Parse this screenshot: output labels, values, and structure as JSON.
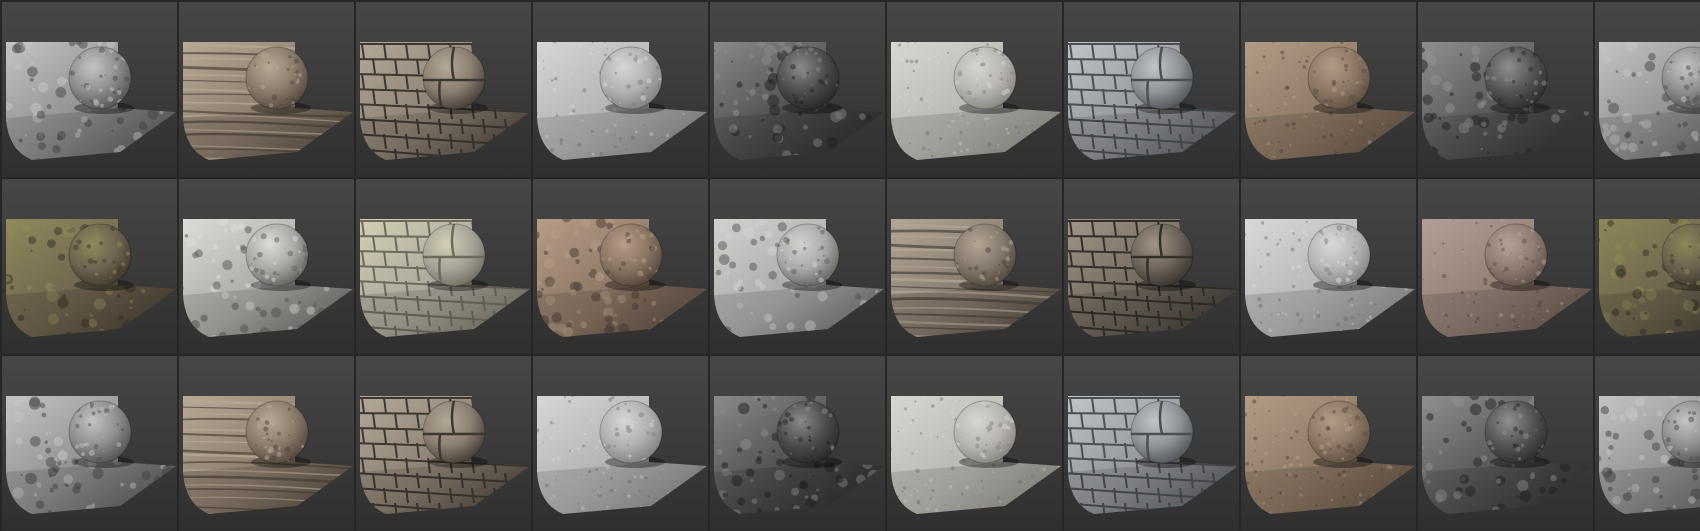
{
  "gallery": {
    "columns": 10,
    "rows": 3,
    "backdrop": {
      "top": "#474747",
      "bottom": "#2f2f2f",
      "separator": "#262626"
    },
    "materials": [
      {
        "name": "rock-gray-cracked",
        "icon": "material-swatch-icon",
        "base": "#8d8d8d",
        "dark": "#4e4e4e",
        "light": "#c4c4c4",
        "pattern": "rock"
      },
      {
        "name": "sandstone-layered",
        "icon": "material-swatch-icon",
        "base": "#8a7b6b",
        "dark": "#4f443a",
        "light": "#b8a996",
        "pattern": "strata"
      },
      {
        "name": "stone-brick-wall",
        "icon": "material-swatch-icon",
        "base": "#8a7e70",
        "dark": "#3e3832",
        "light": "#b3a898",
        "pattern": "bricks"
      },
      {
        "name": "concrete-smooth",
        "icon": "material-swatch-icon",
        "base": "#b0b0b0",
        "dark": "#7d7d7d",
        "light": "#d6d6d6",
        "pattern": "fine"
      },
      {
        "name": "granite-dark-rough",
        "icon": "material-swatch-icon",
        "base": "#4b4b4b",
        "dark": "#262626",
        "light": "#8a8a8a",
        "pattern": "rock"
      },
      {
        "name": "limestone-pale",
        "icon": "material-swatch-icon",
        "base": "#b8b6b1",
        "dark": "#85827c",
        "light": "#d8d6d0",
        "pattern": "fine"
      },
      {
        "name": "stone-blocks-gray",
        "icon": "material-swatch-icon",
        "base": "#8f9296",
        "dark": "#4c4f53",
        "light": "#c2c5c8",
        "pattern": "bricks"
      },
      {
        "name": "sand-brown",
        "icon": "material-swatch-icon",
        "base": "#8c7764",
        "dark": "#5c4c3f",
        "light": "#b29c86",
        "pattern": "fine"
      },
      {
        "name": "gravel-dark",
        "icon": "material-swatch-icon",
        "base": "#535353",
        "dark": "#2a2a2a",
        "light": "#8f8f8f",
        "pattern": "rock"
      },
      {
        "name": "rock-gray-cracked-2",
        "icon": "material-swatch-icon",
        "base": "#8d8d8d",
        "dark": "#4e4e4e",
        "light": "#c4c4c4",
        "pattern": "rock"
      },
      {
        "name": "moss-soil-rock",
        "icon": "material-swatch-icon",
        "base": "#6e6350",
        "dark": "#3d362a",
        "light": "#8f8a5a",
        "pattern": "rock"
      },
      {
        "name": "pebble-white",
        "icon": "material-swatch-icon",
        "base": "#a8a8a4",
        "dark": "#5e5e5b",
        "light": "#dcdcd8",
        "pattern": "pebble"
      },
      {
        "name": "flagstone-lichen",
        "icon": "material-swatch-icon",
        "base": "#a7a49a",
        "dark": "#6e6a5e",
        "light": "#d4cfb3",
        "pattern": "bricks"
      },
      {
        "name": "dirt-gravel-brown",
        "icon": "material-swatch-icon",
        "base": "#8a7563",
        "dark": "#52433a",
        "light": "#b59d87",
        "pattern": "pebble"
      },
      {
        "name": "rock-white-chipped",
        "icon": "material-swatch-icon",
        "base": "#a9a9a7",
        "dark": "#5f5f5c",
        "light": "#d2d2cf",
        "pattern": "rock"
      },
      {
        "name": "sandstone-layered-2",
        "icon": "material-swatch-icon",
        "base": "#85796c",
        "dark": "#4c443b",
        "light": "#b3a696",
        "pattern": "strata"
      },
      {
        "name": "stone-brick-dark",
        "icon": "material-swatch-icon",
        "base": "#6d645a",
        "dark": "#33302b",
        "light": "#a09585",
        "pattern": "bricks"
      },
      {
        "name": "concrete-light",
        "icon": "material-swatch-icon",
        "base": "#b5b5b5",
        "dark": "#818181",
        "light": "#d9d9d9",
        "pattern": "fine"
      },
      {
        "name": "clay-dust-pink",
        "icon": "material-swatch-icon",
        "base": "#8f7c72",
        "dark": "#5e4f48",
        "light": "#b39f95",
        "pattern": "fine"
      },
      {
        "name": "moss-soil-rock-2",
        "icon": "material-swatch-icon",
        "base": "#6b624d",
        "dark": "#3a3429",
        "light": "#8d8758",
        "pattern": "rock"
      },
      {
        "name": "rock-gray-cracked-3",
        "icon": "material-swatch-icon",
        "base": "#8d8d8d",
        "dark": "#4e4e4e",
        "light": "#c4c4c4",
        "pattern": "rock"
      },
      {
        "name": "sandstone-layered-3",
        "icon": "material-swatch-icon",
        "base": "#8a7b6b",
        "dark": "#4f443a",
        "light": "#b8a996",
        "pattern": "strata"
      },
      {
        "name": "stone-brick-wall-2",
        "icon": "material-swatch-icon",
        "base": "#8a7e70",
        "dark": "#3e3832",
        "light": "#b3a898",
        "pattern": "bricks"
      },
      {
        "name": "concrete-smooth-2",
        "icon": "material-swatch-icon",
        "base": "#b0b0b0",
        "dark": "#7d7d7d",
        "light": "#d6d6d6",
        "pattern": "fine"
      },
      {
        "name": "granite-dark-rough-2",
        "icon": "material-swatch-icon",
        "base": "#4b4b4b",
        "dark": "#262626",
        "light": "#8a8a8a",
        "pattern": "rock"
      },
      {
        "name": "limestone-pale-2",
        "icon": "material-swatch-icon",
        "base": "#b8b6b1",
        "dark": "#85827c",
        "light": "#d8d6d0",
        "pattern": "fine"
      },
      {
        "name": "stone-blocks-gray-2",
        "icon": "material-swatch-icon",
        "base": "#8f9296",
        "dark": "#4c4f53",
        "light": "#c2c5c8",
        "pattern": "bricks"
      },
      {
        "name": "sand-brown-2",
        "icon": "material-swatch-icon",
        "base": "#8c7764",
        "dark": "#5c4c3f",
        "light": "#b29c86",
        "pattern": "fine"
      },
      {
        "name": "gravel-dark-2",
        "icon": "material-swatch-icon",
        "base": "#535353",
        "dark": "#2a2a2a",
        "light": "#8f8f8f",
        "pattern": "rock"
      },
      {
        "name": "rock-gray-cracked-4",
        "icon": "material-swatch-icon",
        "base": "#8d8d8d",
        "dark": "#4e4e4e",
        "light": "#c4c4c4",
        "pattern": "rock"
      }
    ]
  }
}
